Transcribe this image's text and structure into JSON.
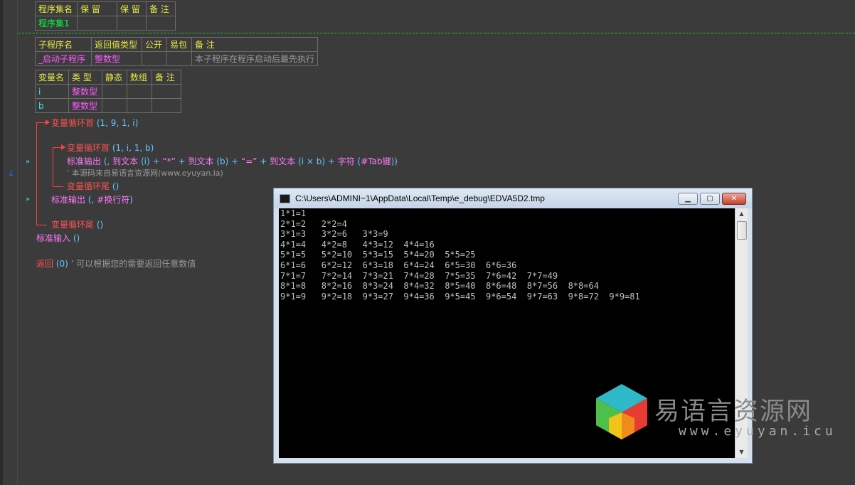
{
  "assembly_table": {
    "headers": [
      "程序集名",
      "保 留",
      "保 留",
      "备 注"
    ],
    "row": [
      "程序集1",
      "",
      "",
      ""
    ]
  },
  "sub_table": {
    "headers": [
      "子程序名",
      "返回值类型",
      "公开",
      "易包",
      "备 注"
    ],
    "row": [
      "_启动子程序",
      "整数型",
      "",
      "",
      "本子程序在程序启动后最先执行"
    ]
  },
  "var_table": {
    "headers": [
      "变量名",
      "类 型",
      "静态",
      "数组",
      "备 注"
    ],
    "rows": [
      [
        "i",
        "整数型",
        "",
        "",
        ""
      ],
      [
        "b",
        "整数型",
        "",
        "",
        ""
      ]
    ]
  },
  "code": {
    "l1_kw": "变量循环首",
    "l1_args": " (1, 9, 1, i)",
    "l2_kw": "变量循环首",
    "l2_args": " (1, i, 1, b)",
    "l3_fn": "标准输出",
    "l3_a": " (, ",
    "l3_b": "到文本",
    "l3_c": " (i) + ",
    "l3_d": "“*”",
    "l3_e": " + ",
    "l3_f": "到文本",
    "l3_g": " (b) + ",
    "l3_h": "“=”",
    "l3_i": " + ",
    "l3_j": "到文本",
    "l3_k": " (i × b) + ",
    "l3_l": "字符",
    "l3_m": " (",
    "l3_n": "#Tab键",
    "l3_o": "))",
    "l4_comment": "’ 本源码来自易语言资源网(www.eyuyan.la)",
    "l5_kw": "变量循环尾",
    "l5_args": " ()",
    "l6_fn": "标准输出",
    "l6_a": " (, ",
    "l6_b": "#换行符",
    "l6_c": ")",
    "l7_kw": "变量循环尾",
    "l7_args": " ()",
    "l8_fn": "标准输入",
    "l8_args": " ()",
    "l9_kw": "返回",
    "l9_args": " (0)",
    "l9_comment": " ’ 可以根据您的需要返回任意数值"
  },
  "console_window": {
    "title": "C:\\Users\\ADMINI~1\\AppData\\Local\\Temp\\e_debug\\EDVA5D2.tmp",
    "output": "1*1=1\n2*1=2   2*2=4\n3*1=3   3*2=6   3*3=9\n4*1=4   4*2=8   4*3=12  4*4=16\n5*1=5   5*2=10  5*3=15  5*4=20  5*5=25\n6*1=6   6*2=12  6*3=18  6*4=24  6*5=30  6*6=36\n7*1=7   7*2=14  7*3=21  7*4=28  7*5=35  7*6=42  7*7=49\n8*1=8   8*2=16  8*3=24  8*4=32  8*5=40  8*6=48  8*7=56  8*8=64\n9*1=9   9*2=18  9*3=27  9*4=36  9*5=45  9*6=54  9*7=63  9*8=72  9*9=81"
  },
  "watermark": {
    "name": "易语言资源网",
    "url": "www.eyuyan.icu"
  }
}
